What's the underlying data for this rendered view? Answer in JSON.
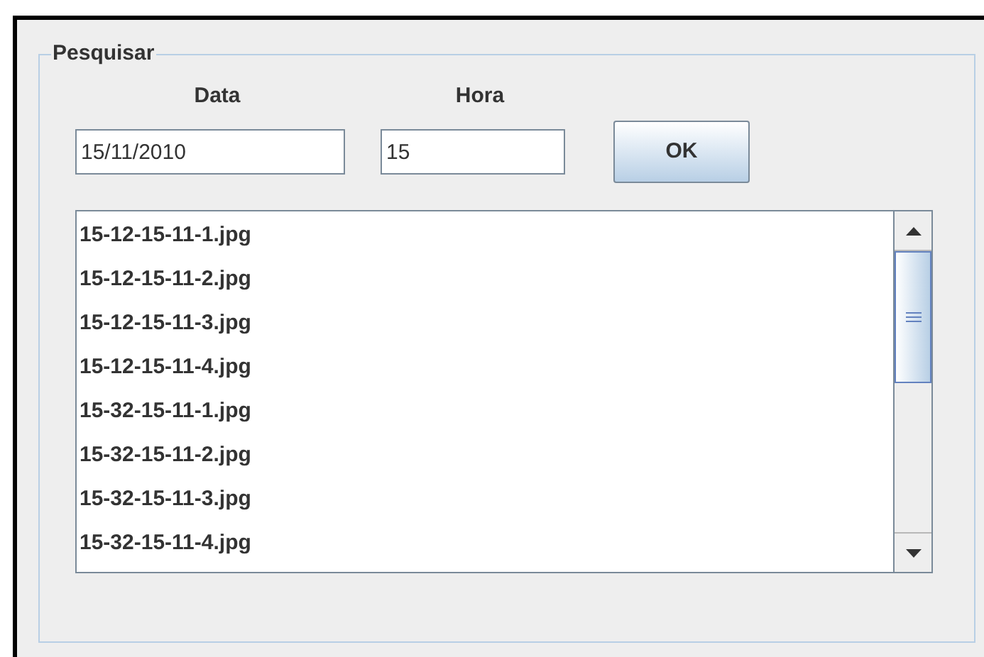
{
  "group": {
    "title": "Pesquisar"
  },
  "fields": [
    {
      "label": "Data",
      "value": "15/11/2010"
    },
    {
      "label": "Hora",
      "value": "15"
    }
  ],
  "ok_button": "OK",
  "files": [
    "15-12-15-11-1.jpg",
    "15-12-15-11-2.jpg",
    "15-12-15-11-3.jpg",
    "15-12-15-11-4.jpg",
    "15-32-15-11-1.jpg",
    "15-32-15-11-2.jpg",
    "15-32-15-11-3.jpg",
    "15-32-15-11-4.jpg"
  ]
}
